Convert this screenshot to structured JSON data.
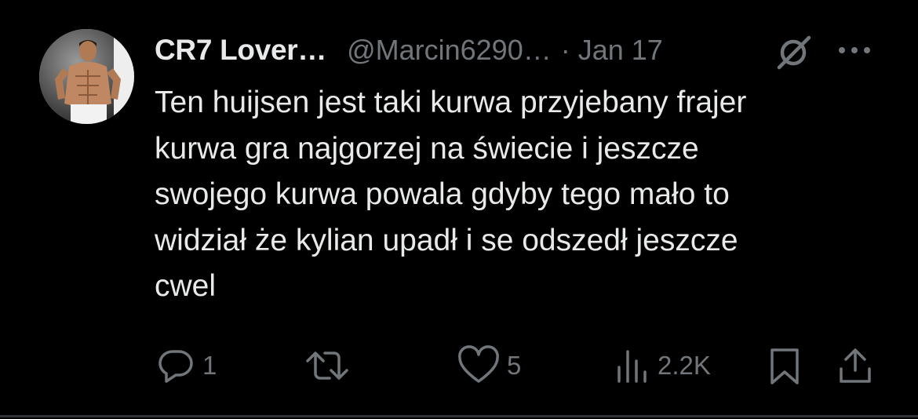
{
  "tweet": {
    "author_name": "CR7 Lover…",
    "handle": "@Marcin6290…",
    "separator": "·",
    "date": "Jan 17",
    "avatar": "avatar-photo",
    "text_lines": [
      "Ten huijsen jest taki kurwa przyjebany frajer",
      "kurwa gra najgorzej na świecie i jeszcze",
      "swojego kurwa powala gdyby tego mało to",
      "widział że kylian upadł i se odszedł jeszcze",
      "cwel"
    ]
  },
  "actions": {
    "reply": {
      "icon": "reply-icon",
      "count": "1"
    },
    "retweet": {
      "icon": "retweet-icon",
      "count": ""
    },
    "like": {
      "icon": "heart-icon",
      "count": "5"
    },
    "views": {
      "icon": "views-icon",
      "count": "2.2K"
    },
    "bookmark": {
      "icon": "bookmark-icon"
    },
    "share": {
      "icon": "share-icon"
    }
  },
  "header_icons": [
    "grok-icon",
    "more-icon"
  ],
  "colors": {
    "background": "#000000",
    "primary_text": "#e7e9ea",
    "secondary_text": "#71767b",
    "divider": "#2f3336"
  }
}
